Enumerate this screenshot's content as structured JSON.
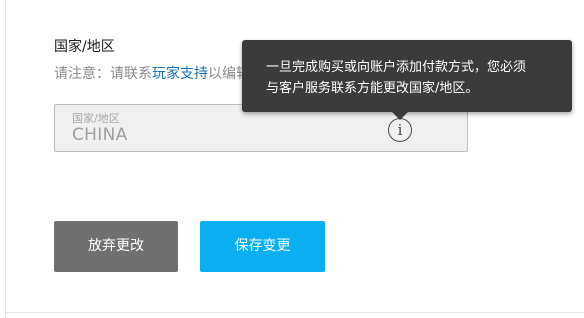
{
  "section": {
    "title": "国家/地区",
    "notice_prefix": "请注意：请联系",
    "notice_link": "玩家支持",
    "notice_suffix": "以编辑"
  },
  "country_field": {
    "label": "国家/地区",
    "value": "CHINA",
    "info_icon_glyph": "i"
  },
  "tooltip": {
    "line1": "一旦完成购买或向账户添加付款方式，您必须",
    "line2": "与客户服务联系方能更改国家/地区。"
  },
  "buttons": {
    "discard_label": "放弃更改",
    "save_label": "保存变更"
  },
  "colors": {
    "save_button": "#0aaff2",
    "discard_button": "#707070",
    "link": "#1a6fb5",
    "tooltip_bg": "#3b3b3b"
  },
  "icons": {
    "info": "info-icon"
  }
}
